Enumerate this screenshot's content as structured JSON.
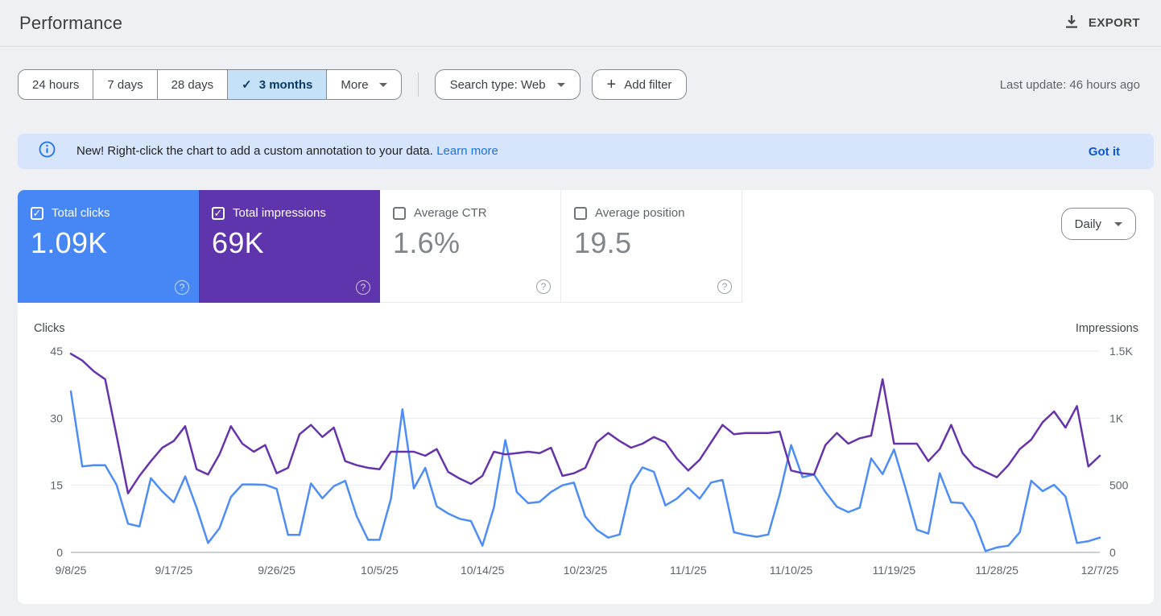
{
  "header": {
    "title": "Performance",
    "export_label": "EXPORT"
  },
  "toolbar": {
    "ranges": [
      {
        "label": "24 hours",
        "selected": false
      },
      {
        "label": "7 days",
        "selected": false
      },
      {
        "label": "28 days",
        "selected": false
      },
      {
        "label": "3 months",
        "selected": true,
        "checkmark": "✓"
      }
    ],
    "more_label": "More",
    "search_type_label": "Search type: Web",
    "add_filter_label": "Add filter",
    "plus_glyph": "+",
    "last_update": "Last update: 46 hours ago"
  },
  "banner": {
    "text": "New! Right-click the chart to add a custom annotation to your data.",
    "link_label": "Learn more",
    "dismiss_label": "Got it"
  },
  "metrics": [
    {
      "label": "Total clicks",
      "value": "1.09K",
      "checked": true,
      "color": "#4686f5"
    },
    {
      "label": "Total impressions",
      "value": "69K",
      "checked": true,
      "color": "#5f35ae"
    },
    {
      "label": "Average CTR",
      "value": "1.6%",
      "checked": false,
      "color": "#ffffff"
    },
    {
      "label": "Average position",
      "value": "19.5",
      "checked": false,
      "color": "#ffffff"
    }
  ],
  "granularity": {
    "label": "Daily"
  },
  "chart_data": {
    "type": "line",
    "num_points": 91,
    "date_start": "9/8/25",
    "date_end": "12/7/25",
    "x_tick_labels": [
      "9/8/25",
      "9/17/25",
      "9/26/25",
      "10/5/25",
      "10/14/25",
      "10/23/25",
      "11/1/25",
      "11/10/25",
      "11/19/25",
      "11/28/25",
      "12/7/25"
    ],
    "x_tick_positions": [
      0,
      9,
      18,
      27,
      36,
      45,
      54,
      63,
      72,
      81,
      90
    ],
    "left_axis": {
      "label": "Clicks",
      "max": 45,
      "ticks": [
        "0",
        "15",
        "30",
        "45"
      ]
    },
    "right_axis": {
      "label": "Impressions",
      "max": 1500,
      "ticks": [
        "0",
        "500",
        "1K",
        "1.5K"
      ]
    },
    "grid": true,
    "series": [
      {
        "name": "Clicks",
        "axis": "left",
        "color": "#4d8df5",
        "values": [
          36,
          19.2,
          19.5,
          19.5,
          15.1,
          6.4,
          5.8,
          16.6,
          13.6,
          11.2,
          17,
          10,
          2.1,
          5.4,
          12.4,
          15.2,
          15.2,
          15.1,
          14.2,
          3.9,
          3.9,
          15.4,
          12.1,
          14.8,
          16,
          8.1,
          2.8,
          2.8,
          12,
          32,
          14.3,
          18.9,
          10.3,
          8.7,
          7.5,
          7,
          1.5,
          10,
          25.1,
          13.5,
          11,
          11.3,
          13.5,
          15,
          15.6,
          8,
          5,
          3.3,
          4,
          15,
          19,
          18,
          10.5,
          12,
          14.4,
          12,
          15.6,
          16.2,
          4.5,
          3.9,
          3.5,
          4,
          13,
          24,
          16.8,
          17.4,
          13.5,
          10.2,
          9,
          10,
          21,
          17.5,
          23,
          14.4,
          5.1,
          4.2,
          17.7,
          11.2,
          11,
          7.1,
          0.3,
          1.1,
          1.5,
          4.5,
          16,
          13.7,
          15.1,
          12.5,
          2.1,
          2.5,
          3.3
        ]
      },
      {
        "name": "Impressions",
        "axis": "right",
        "color": "#6633ab",
        "values": [
          1480,
          1430,
          1350,
          1290,
          870,
          440,
          570,
          680,
          780,
          830,
          940,
          620,
          580,
          730,
          940,
          810,
          750,
          800,
          590,
          630,
          880,
          950,
          860,
          930,
          680,
          650,
          630,
          620,
          750,
          750,
          750,
          720,
          770,
          600,
          550,
          510,
          570,
          750,
          730,
          740,
          750,
          740,
          780,
          570,
          590,
          630,
          820,
          890,
          830,
          780,
          810,
          860,
          820,
          700,
          610,
          690,
          820,
          950,
          880,
          890,
          890,
          890,
          900,
          610,
          590,
          580,
          800,
          890,
          810,
          850,
          870,
          1290,
          810,
          810,
          810,
          680,
          770,
          950,
          740,
          640,
          600,
          560,
          650,
          770,
          840,
          970,
          1050,
          930,
          1090,
          640,
          720
        ]
      }
    ]
  }
}
